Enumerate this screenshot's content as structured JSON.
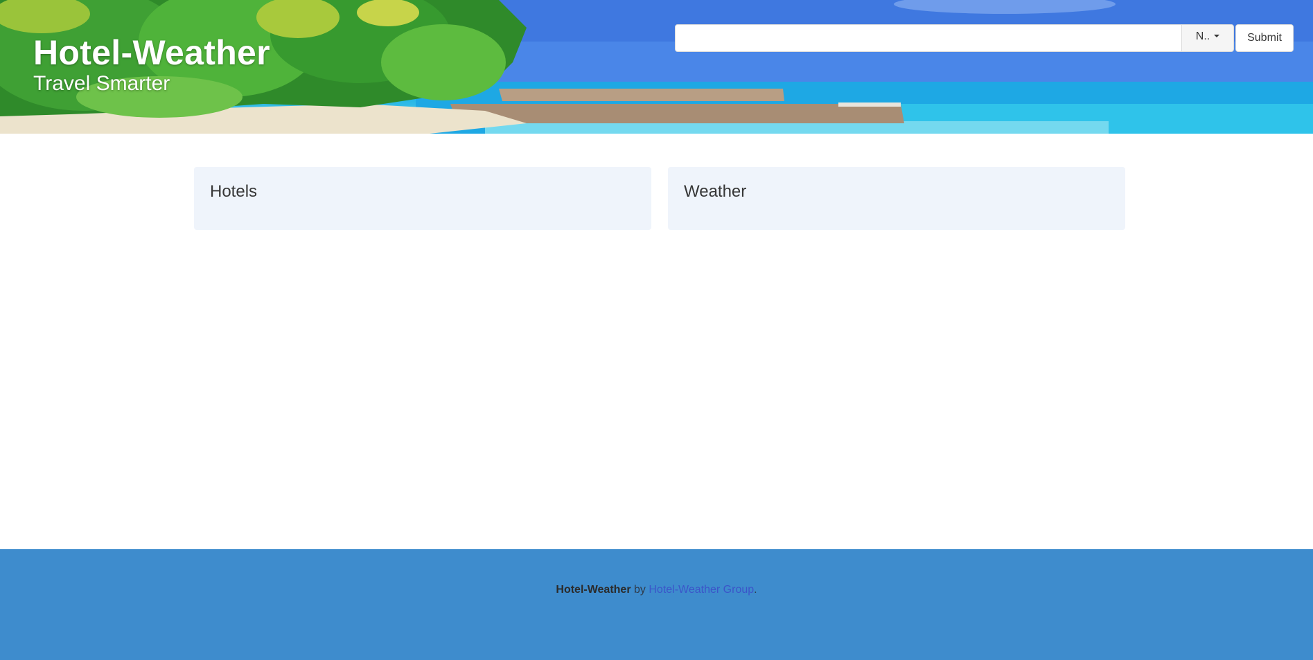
{
  "header": {
    "title": "Hotel-Weather",
    "subtitle": "Travel Smarter",
    "search": {
      "value": "",
      "placeholder": ""
    },
    "dropdown_label": "N..",
    "submit_label": "Submit"
  },
  "main": {
    "panels": [
      {
        "title": "Hotels"
      },
      {
        "title": "Weather"
      }
    ]
  },
  "footer": {
    "brand": "Hotel-Weather",
    "by_text": "by",
    "link_text": "Hotel-Weather Group",
    "trailing": "."
  },
  "colors": {
    "footer_bg": "#3e8ccd",
    "panel_bg": "#eff4fb",
    "link": "#3b55c9"
  }
}
